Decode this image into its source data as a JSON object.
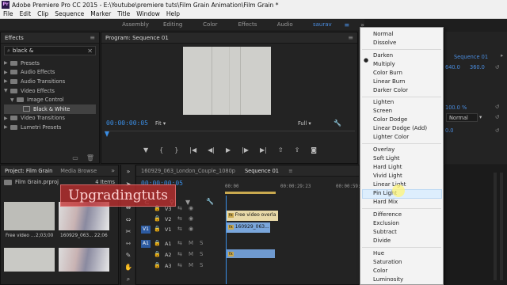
{
  "window": {
    "title": "Adobe Premiere Pro CC 2015 - E:\\Youtube\\premiere tuts\\Film Grain Animation\\Film Grain *",
    "app_icon": "Pr"
  },
  "menu": [
    "File",
    "Edit",
    "Clip",
    "Sequence",
    "Marker",
    "Title",
    "Window",
    "Help"
  ],
  "workspaces": [
    "Assembly",
    "Editing",
    "Color",
    "Effects",
    "Audio",
    "saurav"
  ],
  "effects_panel": {
    "title": "Effects",
    "search_value": "black &",
    "items": [
      {
        "label": "Presets",
        "level": 0
      },
      {
        "label": "Audio Effects",
        "level": 0
      },
      {
        "label": "Audio Transitions",
        "level": 0
      },
      {
        "label": "Video Effects",
        "level": 0
      },
      {
        "label": "Image Control",
        "level": 1
      },
      {
        "label": "Black & White",
        "level": 2
      },
      {
        "label": "Video Transitions",
        "level": 0
      },
      {
        "label": "Lumetri Presets",
        "level": 0
      }
    ]
  },
  "program": {
    "title": "Program: Sequence 01",
    "timecode": "00:00:00:05",
    "fit": "Fit",
    "quality": "Full"
  },
  "blend_modes": {
    "selected": "Normal",
    "hovered": "Hard Light",
    "groups": [
      [
        "Normal",
        "Dissolve"
      ],
      [
        "Darken",
        "Multiply",
        "Color Burn",
        "Linear Burn",
        "Darker Color"
      ],
      [
        "Lighten",
        "Screen",
        "Color Dodge",
        "Linear Dodge (Add)",
        "Lighter Color"
      ],
      [
        "Overlay",
        "Soft Light",
        "Hard Light",
        "Vivid Light",
        "Linear Light",
        "Pin Light",
        "Hard Mix"
      ],
      [
        "Difference",
        "Exclusion",
        "Subtract",
        "Divide"
      ],
      [
        "Hue",
        "Saturation",
        "Color",
        "Luminosity"
      ]
    ]
  },
  "effect_controls": {
    "sequence_label": "Sequence 01",
    "value_a": "640.0",
    "value_b": "360.0",
    "opacity": "100.0 %",
    "blend_value": "Normal",
    "value_c": "0.0"
  },
  "project": {
    "tabs": [
      "Project: Film Grain",
      "Media Browse"
    ],
    "file": "Film Grain.prproj",
    "count": "4 Items",
    "thumbs": [
      {
        "label": "Free video ...",
        "duration": "2;03;00"
      },
      {
        "label": "160929_063...",
        "duration": "22;06"
      }
    ]
  },
  "timeline": {
    "tabs": [
      "160929_063_London_Couple_1080p",
      "Sequence 01"
    ],
    "timecode": "00:00:00:05",
    "ruler": [
      "00:00",
      "00:00:29:23",
      "00:00:59:22"
    ],
    "tracks": {
      "video": [
        "V3",
        "V2",
        "V1"
      ],
      "audio": [
        "A1",
        "A2",
        "A3"
      ],
      "src_video": "V1",
      "src_audio": "A1"
    },
    "clips": {
      "adjust": "Free video overla",
      "video": "160929_063..."
    }
  },
  "watermark": "Upgradingtuts"
}
